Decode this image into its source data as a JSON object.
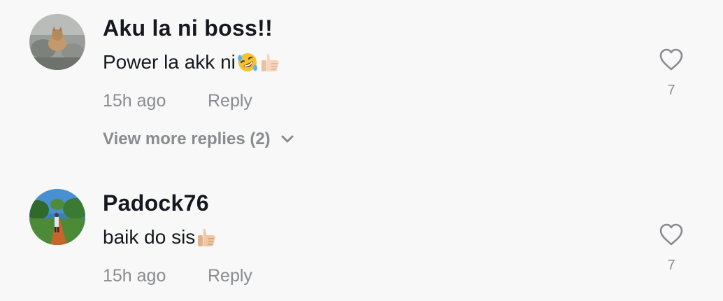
{
  "comments": [
    {
      "username": "Aku la ni boss!!",
      "text": "Power la akk ni",
      "emojis": [
        "rolling-on-floor-laughing-emoji",
        "thumbs-up-emoji"
      ],
      "time": "15h ago",
      "reply_label": "Reply",
      "likes": "7",
      "icon": "heart-outline-icon"
    },
    {
      "username": "Padock76",
      "text": "baik do sis ",
      "emojis": [
        "thumbs-up-emoji"
      ],
      "time": "15h ago",
      "reply_label": "Reply",
      "likes": "7",
      "icon": "heart-outline-icon"
    }
  ],
  "view_more": {
    "label": "View more replies (2)",
    "icon": "chevron-down-icon"
  },
  "colors": {
    "background": "#f8f8f8",
    "text_primary": "#16181f",
    "text_secondary": "#8a8b91"
  }
}
